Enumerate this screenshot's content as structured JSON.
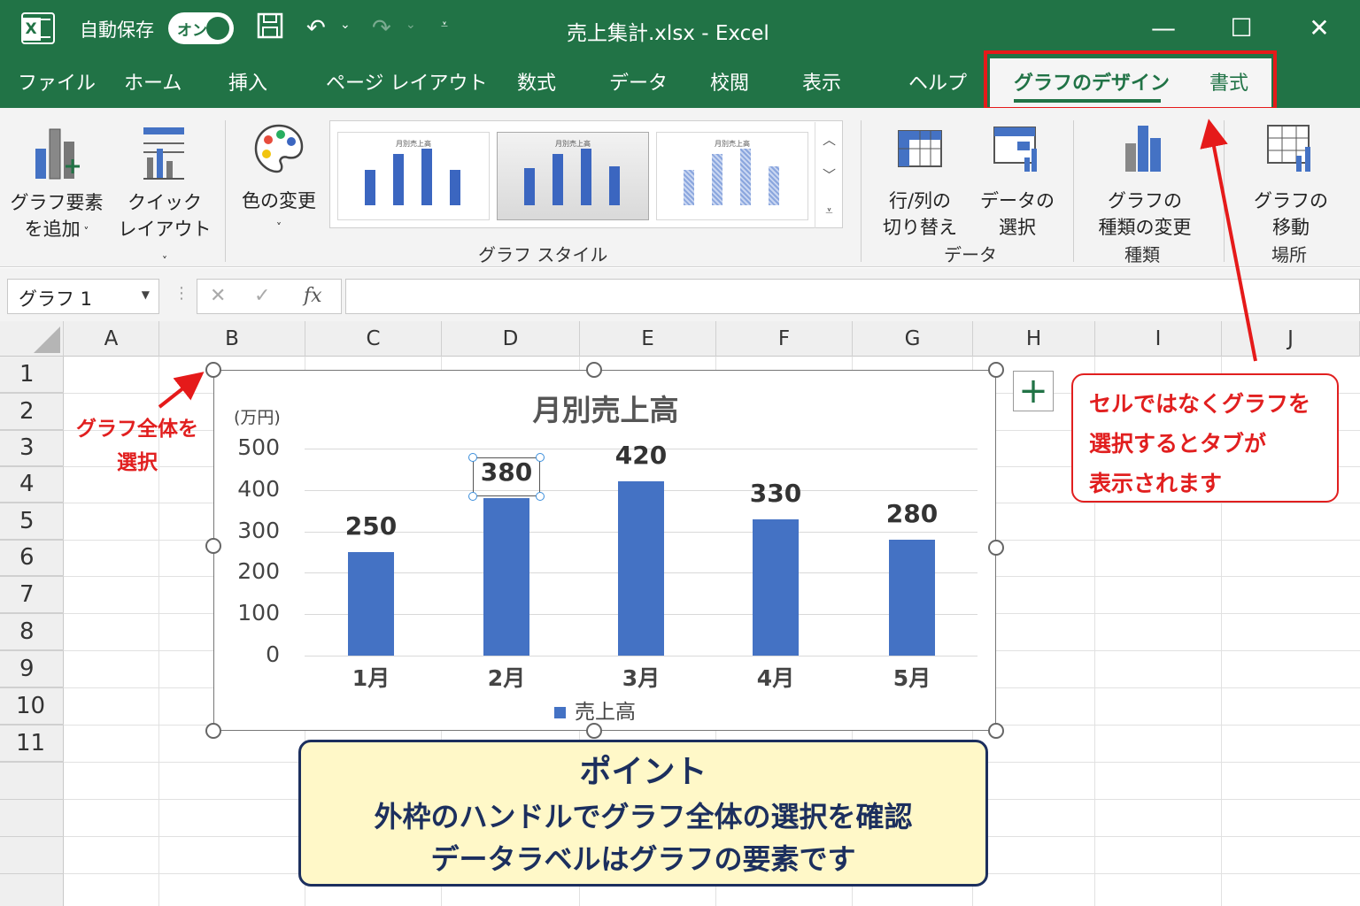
{
  "titlebar": {
    "autosave_label": "自動保存",
    "autosave_state": "オン",
    "doc_title": "売上集計.xlsx  -  Excel",
    "minimize": "—",
    "maximize": "☐",
    "close": "✕"
  },
  "tabs": [
    "ファイル",
    "ホーム",
    "挿入",
    "ページ レイアウト",
    "数式",
    "データ",
    "校閲",
    "表示",
    "ヘルプ",
    "グラフのデザイン",
    "書式"
  ],
  "ribbon": {
    "add_element": [
      "グラフ要素",
      "を追加"
    ],
    "quick_layout": [
      "クイック",
      "レイアウト"
    ],
    "change_color": "色の変更",
    "group_styles": "グラフ スタイル",
    "switch_rowcol": [
      "行/列の",
      "切り替え"
    ],
    "select_data": [
      "データの",
      "選択"
    ],
    "group_data": "データ",
    "change_type": [
      "グラフの",
      "種類の変更"
    ],
    "group_type": "種類",
    "move_chart": [
      "グラフの",
      "移動"
    ],
    "group_location": "場所",
    "style_thumb_title": "月別売上高"
  },
  "formula_bar": {
    "name_box": "グラフ 1",
    "fx": "fx",
    "value": ""
  },
  "columns": [
    "A",
    "B",
    "C",
    "D",
    "E",
    "F",
    "G",
    "H",
    "I",
    "J"
  ],
  "rows": [
    "1",
    "2",
    "3",
    "4",
    "5",
    "6",
    "7",
    "8",
    "9",
    "10",
    "11"
  ],
  "chart_data": {
    "type": "bar",
    "title": "月別売上高",
    "ylabel": "(万円)",
    "categories": [
      "1月",
      "2月",
      "3月",
      "4月",
      "5月"
    ],
    "series": [
      {
        "name": "売上高",
        "values": [
          250,
          380,
          420,
          330,
          280
        ]
      }
    ],
    "yticks": [
      "500",
      "400",
      "300",
      "200",
      "100",
      "0"
    ],
    "ylim": [
      0,
      500
    ],
    "color": "#4472c4",
    "legend": "bottom",
    "grid": true
  },
  "annotations": {
    "left_note": [
      "グラフ全体を",
      "選択"
    ],
    "right_note": [
      "セルではなくグラフを",
      "選択するとタブが",
      "表示されます"
    ],
    "point_title": "ポイント",
    "point_lines": [
      "外枠のハンドルでグラフ全体の選択を確認",
      "データラベルはグラフの要素です"
    ]
  },
  "colors": {
    "excel_green": "#217346",
    "bar_blue": "#4472c4",
    "annotation_red": "#e11f1f",
    "point_bg": "#fff8c8",
    "point_border": "#1c2f5e"
  }
}
